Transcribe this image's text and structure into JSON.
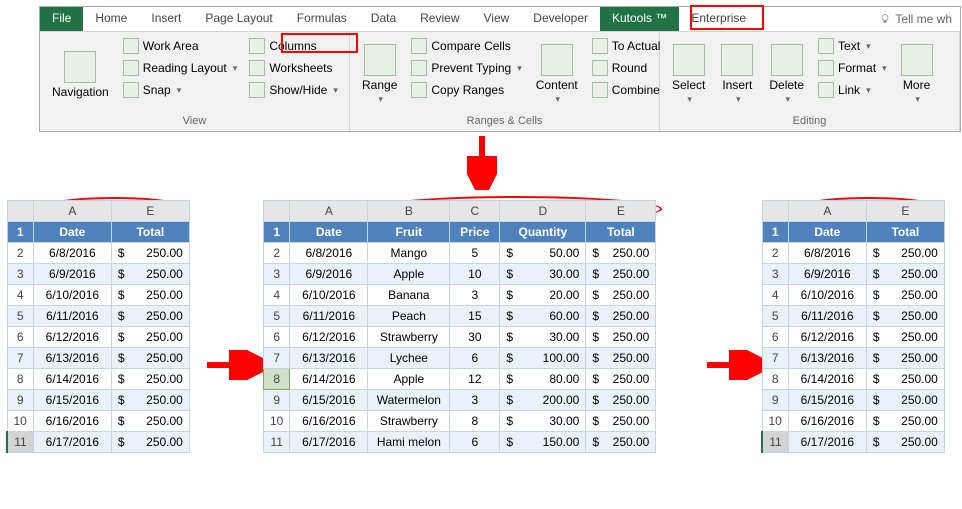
{
  "tabs": {
    "file": "File",
    "home": "Home",
    "insert": "Insert",
    "page_layout": "Page Layout",
    "formulas": "Formulas",
    "data": "Data",
    "review": "Review",
    "view": "View",
    "developer": "Developer",
    "kutools": "Kutools ™",
    "enterprise": "Enterprise",
    "tellme": "Tell me wh"
  },
  "ribbon": {
    "view": {
      "navigation": "Navigation",
      "work_area": "Work Area",
      "reading_layout": "Reading Layout",
      "snap": "Snap",
      "columns": "Columns",
      "worksheets": "Worksheets",
      "show_hide": "Show/Hide",
      "label": "View"
    },
    "ranges": {
      "range": "Range",
      "compare": "Compare Cells",
      "prevent": "Prevent Typing",
      "copy": "Copy Ranges",
      "content": "Content",
      "to_actual": "To Actual",
      "round": "Round",
      "combine": "Combine",
      "label": "Ranges & Cells"
    },
    "editing": {
      "select": "Select",
      "insert": "Insert",
      "delete": "Delete",
      "text": "Text",
      "format": "Format",
      "link": "Link",
      "more": "More",
      "label": "Editing"
    }
  },
  "headers": {
    "date": "Date",
    "fruit": "Fruit",
    "price": "Price",
    "quantity": "Quantity",
    "total": "Total"
  },
  "cols": {
    "A": "A",
    "B": "B",
    "C": "C",
    "D": "D",
    "E": "E"
  },
  "rows": [
    "1",
    "2",
    "3",
    "4",
    "5",
    "6",
    "7",
    "8",
    "9",
    "10",
    "11"
  ],
  "data": [
    {
      "date": "6/8/2016",
      "fruit": "Mango",
      "price": "5",
      "qty": "50.00",
      "total": "250.00"
    },
    {
      "date": "6/9/2016",
      "fruit": "Apple",
      "price": "10",
      "qty": "30.00",
      "total": "250.00"
    },
    {
      "date": "6/10/2016",
      "fruit": "Banana",
      "price": "3",
      "qty": "20.00",
      "total": "250.00"
    },
    {
      "date": "6/11/2016",
      "fruit": "Peach",
      "price": "15",
      "qty": "60.00",
      "total": "250.00"
    },
    {
      "date": "6/12/2016",
      "fruit": "Strawberry",
      "price": "30",
      "qty": "30.00",
      "total": "250.00"
    },
    {
      "date": "6/13/2016",
      "fruit": "Lychee",
      "price": "6",
      "qty": "100.00",
      "total": "250.00"
    },
    {
      "date": "6/14/2016",
      "fruit": "Apple",
      "price": "12",
      "qty": "80.00",
      "total": "250.00"
    },
    {
      "date": "6/15/2016",
      "fruit": "Watermelon",
      "price": "3",
      "qty": "200.00",
      "total": "250.00"
    },
    {
      "date": "6/16/2016",
      "fruit": "Strawberry",
      "price": "8",
      "qty": "30.00",
      "total": "250.00"
    },
    {
      "date": "6/17/2016",
      "fruit": "Hami melon",
      "price": "6",
      "qty": "150.00",
      "total": "250.00"
    }
  ],
  "currency": "$"
}
